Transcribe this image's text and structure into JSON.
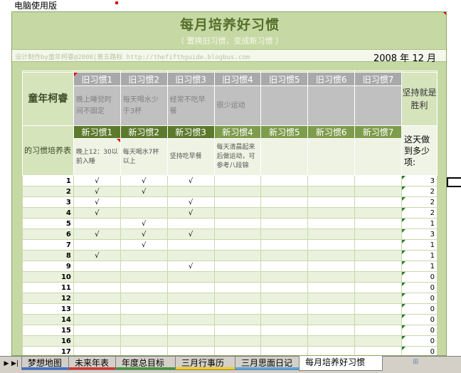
{
  "window": {
    "title": "电脑使用版"
  },
  "header": {
    "title": "每月培养好习惯",
    "subtitle": "（ 置换旧习惯，变成新习惯 ）",
    "credit": "设计制作by童年柯睿@2008|第五路标 http://thefifthguide.blogbus.com",
    "date": "2008 年 12 月"
  },
  "table": {
    "name": "童年柯睿",
    "left_label": "的习惯培养表",
    "persist_label": "坚持就是胜利",
    "count_label": "这天做到多少项:",
    "habits": [
      {
        "old": "旧习惯1",
        "old_desc": "晚上睡觉时间不固定",
        "new": "新习惯1",
        "new_desc": "晚上12：30以前入睡"
      },
      {
        "old": "旧习惯2",
        "old_desc": "每天喝水少于3杯",
        "new": "新习惯2",
        "new_desc": "每天喝水7杯以上"
      },
      {
        "old": "旧习惯3",
        "old_desc": "经常不吃早餐",
        "new": "新习惯3",
        "new_desc": "坚持吃早餐"
      },
      {
        "old": "旧习惯4",
        "old_desc": "很少运动",
        "new": "新习惯4",
        "new_desc": "每天清晨起来后做运动，可参考八段锦"
      },
      {
        "old": "旧习惯5",
        "old_desc": "",
        "new": "新习惯5",
        "new_desc": ""
      },
      {
        "old": "旧习惯6",
        "old_desc": "",
        "new": "新习惯6",
        "new_desc": ""
      },
      {
        "old": "旧习惯7",
        "old_desc": "",
        "new": "新习惯7",
        "new_desc": ""
      }
    ],
    "rows": [
      {
        "day": "1",
        "marks": [
          "√",
          "√",
          "√",
          "",
          "",
          "",
          ""
        ],
        "count": "3"
      },
      {
        "day": "2",
        "marks": [
          "√",
          "√",
          "",
          "",
          "",
          "",
          ""
        ],
        "count": "2"
      },
      {
        "day": "3",
        "marks": [
          "√",
          "",
          "√",
          "",
          "",
          "",
          ""
        ],
        "count": "2"
      },
      {
        "day": "4",
        "marks": [
          "√",
          "",
          "√",
          "",
          "",
          "",
          ""
        ],
        "count": "2"
      },
      {
        "day": "5",
        "marks": [
          "",
          "√",
          "",
          "",
          "",
          "",
          ""
        ],
        "count": "1"
      },
      {
        "day": "6",
        "marks": [
          "√",
          "√",
          "√",
          "",
          "",
          "",
          ""
        ],
        "count": "3"
      },
      {
        "day": "7",
        "marks": [
          "",
          "√",
          "",
          "",
          "",
          "",
          ""
        ],
        "count": "1"
      },
      {
        "day": "8",
        "marks": [
          "√",
          "",
          "",
          "",
          "",
          "",
          ""
        ],
        "count": "1"
      },
      {
        "day": "9",
        "marks": [
          "",
          "",
          "√",
          "",
          "",
          "",
          ""
        ],
        "count": "1"
      },
      {
        "day": "10",
        "marks": [
          "",
          "",
          "",
          "",
          "",
          "",
          ""
        ],
        "count": "0"
      },
      {
        "day": "11",
        "marks": [
          "",
          "",
          "",
          "",
          "",
          "",
          ""
        ],
        "count": "0"
      },
      {
        "day": "12",
        "marks": [
          "",
          "",
          "",
          "",
          "",
          "",
          ""
        ],
        "count": "0"
      },
      {
        "day": "13",
        "marks": [
          "",
          "",
          "",
          "",
          "",
          "",
          ""
        ],
        "count": "0"
      },
      {
        "day": "14",
        "marks": [
          "",
          "",
          "",
          "",
          "",
          "",
          ""
        ],
        "count": "0"
      },
      {
        "day": "15",
        "marks": [
          "",
          "",
          "",
          "",
          "",
          "",
          ""
        ],
        "count": "0"
      },
      {
        "day": "16",
        "marks": [
          "",
          "",
          "",
          "",
          "",
          "",
          ""
        ],
        "count": "0"
      },
      {
        "day": "17",
        "marks": [
          "",
          "",
          "",
          "",
          "",
          "",
          ""
        ],
        "count": "0"
      }
    ]
  },
  "sheet_tabs": [
    {
      "label": "梦想地图",
      "color": "#3a6fd8",
      "active": false
    },
    {
      "label": "未来年表",
      "color": "#e03030",
      "active": false
    },
    {
      "label": "年度总目标",
      "color": "#3a9a3a",
      "active": false
    },
    {
      "label": "三月行事历",
      "color": "#f0d000",
      "active": false
    },
    {
      "label": "三月思面日记",
      "color": "#4aa8e8",
      "active": false
    },
    {
      "label": "每月培养好习惯",
      "color": "#3a9a3a",
      "active": true
    }
  ],
  "nav_icons": [
    "first-sheet-icon",
    "next-sheet-icon"
  ],
  "colors": {
    "sheet_bg": "#c6d9a4",
    "title": "#556e2c",
    "old_header": "#a9a9a9",
    "new_header": "#5c7a2c"
  }
}
